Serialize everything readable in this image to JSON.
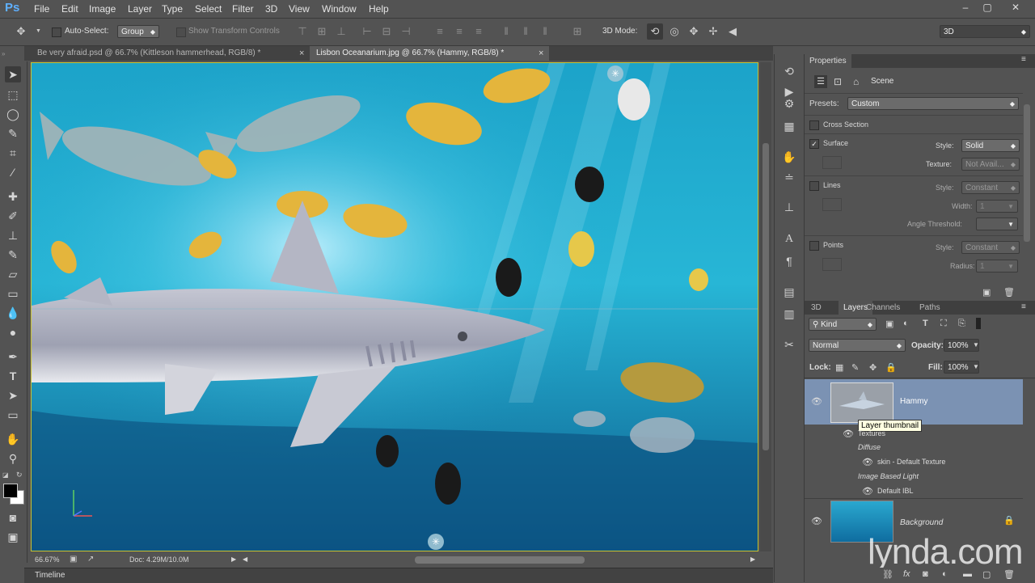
{
  "app": {
    "logo": "Ps"
  },
  "menu": [
    "File",
    "Edit",
    "Image",
    "Layer",
    "Type",
    "Select",
    "Filter",
    "3D",
    "View",
    "Window",
    "Help"
  ],
  "window_controls": [
    "–",
    "▢",
    "✕"
  ],
  "options": {
    "auto_select_label": "Auto-Select:",
    "auto_select_value": "Group",
    "show_transform_label": "Show Transform Controls",
    "mode_3d_label": "3D Mode:",
    "workspace_value": "3D"
  },
  "tabs": [
    {
      "label": "Be very afraid.psd @ 66.7% (Kittleson hammerhead, RGB/8) *",
      "close": "×",
      "active": false
    },
    {
      "label": "Lisbon Oceanarium.jpg @ 66.7% (Hammy, RGB/8) *",
      "close": "×",
      "active": true
    }
  ],
  "status": {
    "zoom": "66.67%",
    "doc": "Doc: 4.29M/10.0M"
  },
  "timeline": {
    "label": "Timeline"
  },
  "properties": {
    "title": "Properties",
    "scene_label": "Scene",
    "presets_label": "Presets:",
    "presets_value": "Custom",
    "cross_section_label": "Cross Section",
    "surface": {
      "label": "Surface",
      "style_label": "Style:",
      "style_value": "Solid",
      "texture_label": "Texture:",
      "texture_value": "Not Avail..."
    },
    "lines": {
      "label": "Lines",
      "style_label": "Style:",
      "style_value": "Constant",
      "width_label": "Width:",
      "width_value": "1",
      "angle_label": "Angle Threshold:"
    },
    "points": {
      "label": "Points",
      "style_label": "Style:",
      "style_value": "Constant",
      "radius_label": "Radius:",
      "radius_value": "1"
    }
  },
  "layers_panel": {
    "tabs": [
      "3D",
      "Layers",
      "Channels",
      "Paths"
    ],
    "kind_value": "Kind",
    "blend_value": "Normal",
    "opacity_label": "Opacity:",
    "opacity_value": "100%",
    "lock_label": "Lock:",
    "fill_label": "Fill:",
    "fill_value": "100%",
    "layers": [
      {
        "name": "Hammy",
        "tooltip": "Layer thumbnail"
      },
      {
        "name": "Background"
      }
    ],
    "sublist": {
      "textures": "Textures",
      "diffuse": "Diffuse",
      "skin": "skin - Default Texture",
      "ibl": "Image Based Light",
      "default_ibl": "Default IBL"
    }
  },
  "watermark": "lynda.com",
  "colors": {
    "accent": "#5fb0ff",
    "canvas_border": "#c9c22f",
    "selected_layer": "#7b92b3"
  }
}
